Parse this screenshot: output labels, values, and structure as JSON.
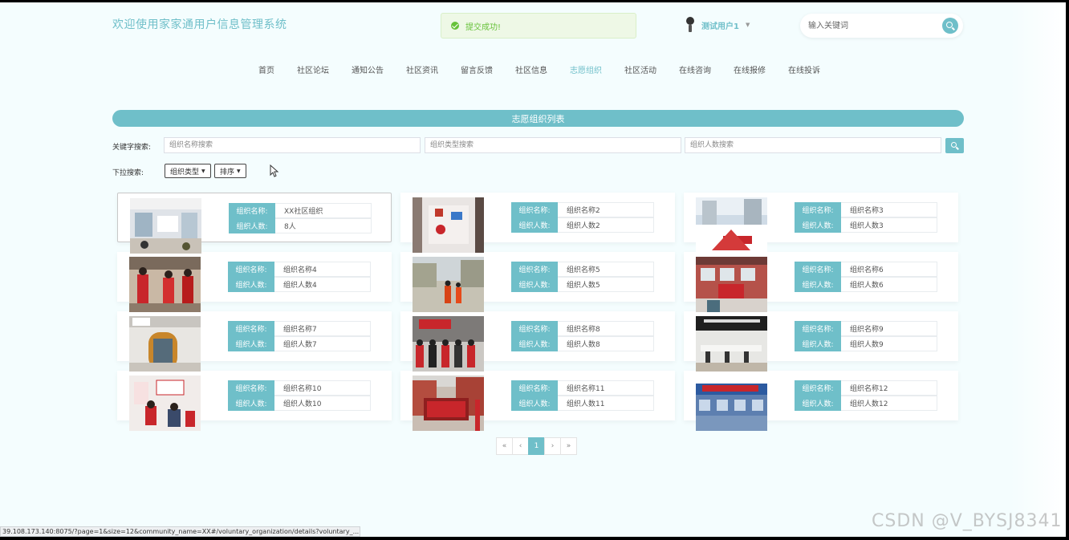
{
  "header": {
    "site_title": "欢迎使用家家通用户信息管理系统",
    "toast": "提交成功!",
    "user_name": "测试用户1",
    "search_placeholder": "输入关键词"
  },
  "nav": {
    "items": [
      "首页",
      "社区论坛",
      "通知公告",
      "社区资讯",
      "留言反馈",
      "社区信息",
      "志愿组织",
      "社区活动",
      "在线咨询",
      "在线报修",
      "在线投诉"
    ],
    "active_index": 6
  },
  "banner": {
    "title": "志愿组织列表"
  },
  "search": {
    "keyword_label": "关键字搜索:",
    "name_placeholder": "组织名称搜索",
    "type_placeholder": "组织类型搜索",
    "count_placeholder": "组织人数搜索",
    "dropdown_label": "下拉搜索:",
    "type_dropdown": "组织类型",
    "sort_dropdown": "排序"
  },
  "labels": {
    "name": "组织名称:",
    "count": "组织人数:"
  },
  "cards": [
    {
      "name": "XX社区组织",
      "count": "8人",
      "icon": "photo-community-office"
    },
    {
      "name": "组织名称2",
      "count": "组织人数2",
      "icon": "photo-wall-display"
    },
    {
      "name": "组织名称3",
      "count": "组织人数3",
      "icon": "photo-building-sign"
    },
    {
      "name": "组织名称4",
      "count": "组织人数4",
      "icon": "photo-volunteers"
    },
    {
      "name": "组织名称5",
      "count": "组织人数5",
      "icon": "photo-street-volunteers"
    },
    {
      "name": "组织名称6",
      "count": "组织人数6",
      "icon": "photo-community-building"
    },
    {
      "name": "组织名称7",
      "count": "组织人数7",
      "icon": "photo-service-window"
    },
    {
      "name": "组织名称8",
      "count": "组织人数8",
      "icon": "photo-group"
    },
    {
      "name": "组织名称9",
      "count": "组织人数9",
      "icon": "photo-meeting-room"
    },
    {
      "name": "组织名称10",
      "count": "组织人数10",
      "icon": "photo-consultation"
    },
    {
      "name": "组织名称11",
      "count": "组织人数11",
      "icon": "photo-notice-board"
    },
    {
      "name": "组织名称12",
      "count": "组织人数12",
      "icon": "photo-service-center"
    }
  ],
  "pagination": {
    "first": "«",
    "prev": "‹",
    "current": "1",
    "next": "›",
    "last": "»"
  },
  "status_url": "39.108.173.140:8075/?page=1&size=12&community_name=XX#/voluntary_organization/details?voluntary_...",
  "watermark": "CSDN @V_BYSJ8341",
  "colors": {
    "accent": "#6fbfc9",
    "toast_text": "#67c23a"
  }
}
